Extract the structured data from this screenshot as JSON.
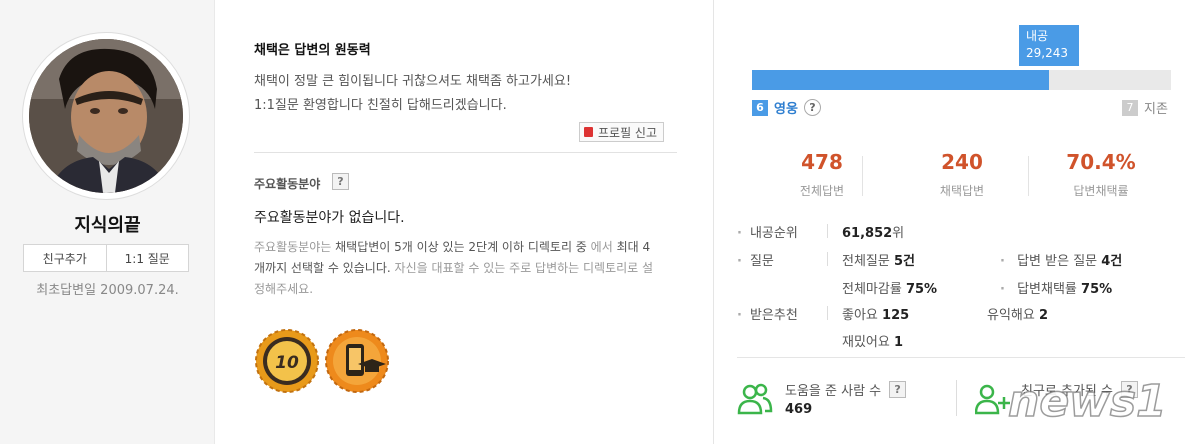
{
  "profile": {
    "nickname": "지식의끝",
    "add_friend_label": "친구추가",
    "one_on_one_label": "1:1 질문",
    "first_answer_text": "최초답변일 2009.07.24."
  },
  "intro": {
    "title": "채택은 답변의 원동력",
    "lines": [
      "채택이 정말 큰 힘이됩니다 귀찮으셔도 채택좀 하고가세요!",
      "1:1질문 환영합니다 친절히 답해드리겠습니다."
    ],
    "report_label": "프로필 신고"
  },
  "activity_area": {
    "title": "주요활동분야",
    "help": "?",
    "empty_text": "주요활동분야가 없습니다.",
    "desc_lead": "주요활동분야는",
    "desc_strong": "채택답변이 5개 이상 있는 2단계 이하 디렉토리 중",
    "desc_mid": "에서",
    "desc_strong2": "최대 4개까지 선택할 수 있습니다.",
    "desc_tail": "자신을 대표할 수 있는 주로 답변하는 디렉토리로 설정해주세요."
  },
  "badges": [
    {
      "icon": "ten-medal-icon",
      "text": "10"
    },
    {
      "icon": "mobile-graduate-medal-icon"
    }
  ],
  "level": {
    "exp_label": "내공",
    "exp_value": "29,243",
    "progress": 0.71,
    "current_num": "6",
    "current_name": "영웅",
    "next_num": "7",
    "next_name": "지존",
    "help": "?"
  },
  "stats": [
    {
      "value": "478",
      "label": "전체답변"
    },
    {
      "value": "240",
      "label": "채택답변"
    },
    {
      "value": "70.4%",
      "label": "답변채택률"
    }
  ],
  "details": {
    "rank_label": "내공순위",
    "rank_value": "61,852",
    "rank_unit": "위",
    "question_label": "질문",
    "total_q_label": "전체질문",
    "total_q_value": "5건",
    "received_q_label": "답변 받은 질문",
    "received_q_value": "4건",
    "close_rate_label": "전체마감률",
    "close_rate_value": "75%",
    "adopt_rate_label": "답변채택률",
    "adopt_rate_value": "75%",
    "rec_label": "받은추천",
    "like_label": "좋아요",
    "like_value": "125",
    "useful_label": "유익해요",
    "useful_value": "2",
    "fun_label": "재밌어요",
    "fun_value": "1"
  },
  "bottom": {
    "helped_label": "도움을 준 사람 수",
    "helped_value": "469",
    "friend_label": "친구로 추가된 수",
    "help": "?"
  },
  "watermark": "news1",
  "colors": {
    "accent_blue": "#4a9be6",
    "stat_orange": "#d0532b",
    "icon_green": "#3bb54a"
  }
}
